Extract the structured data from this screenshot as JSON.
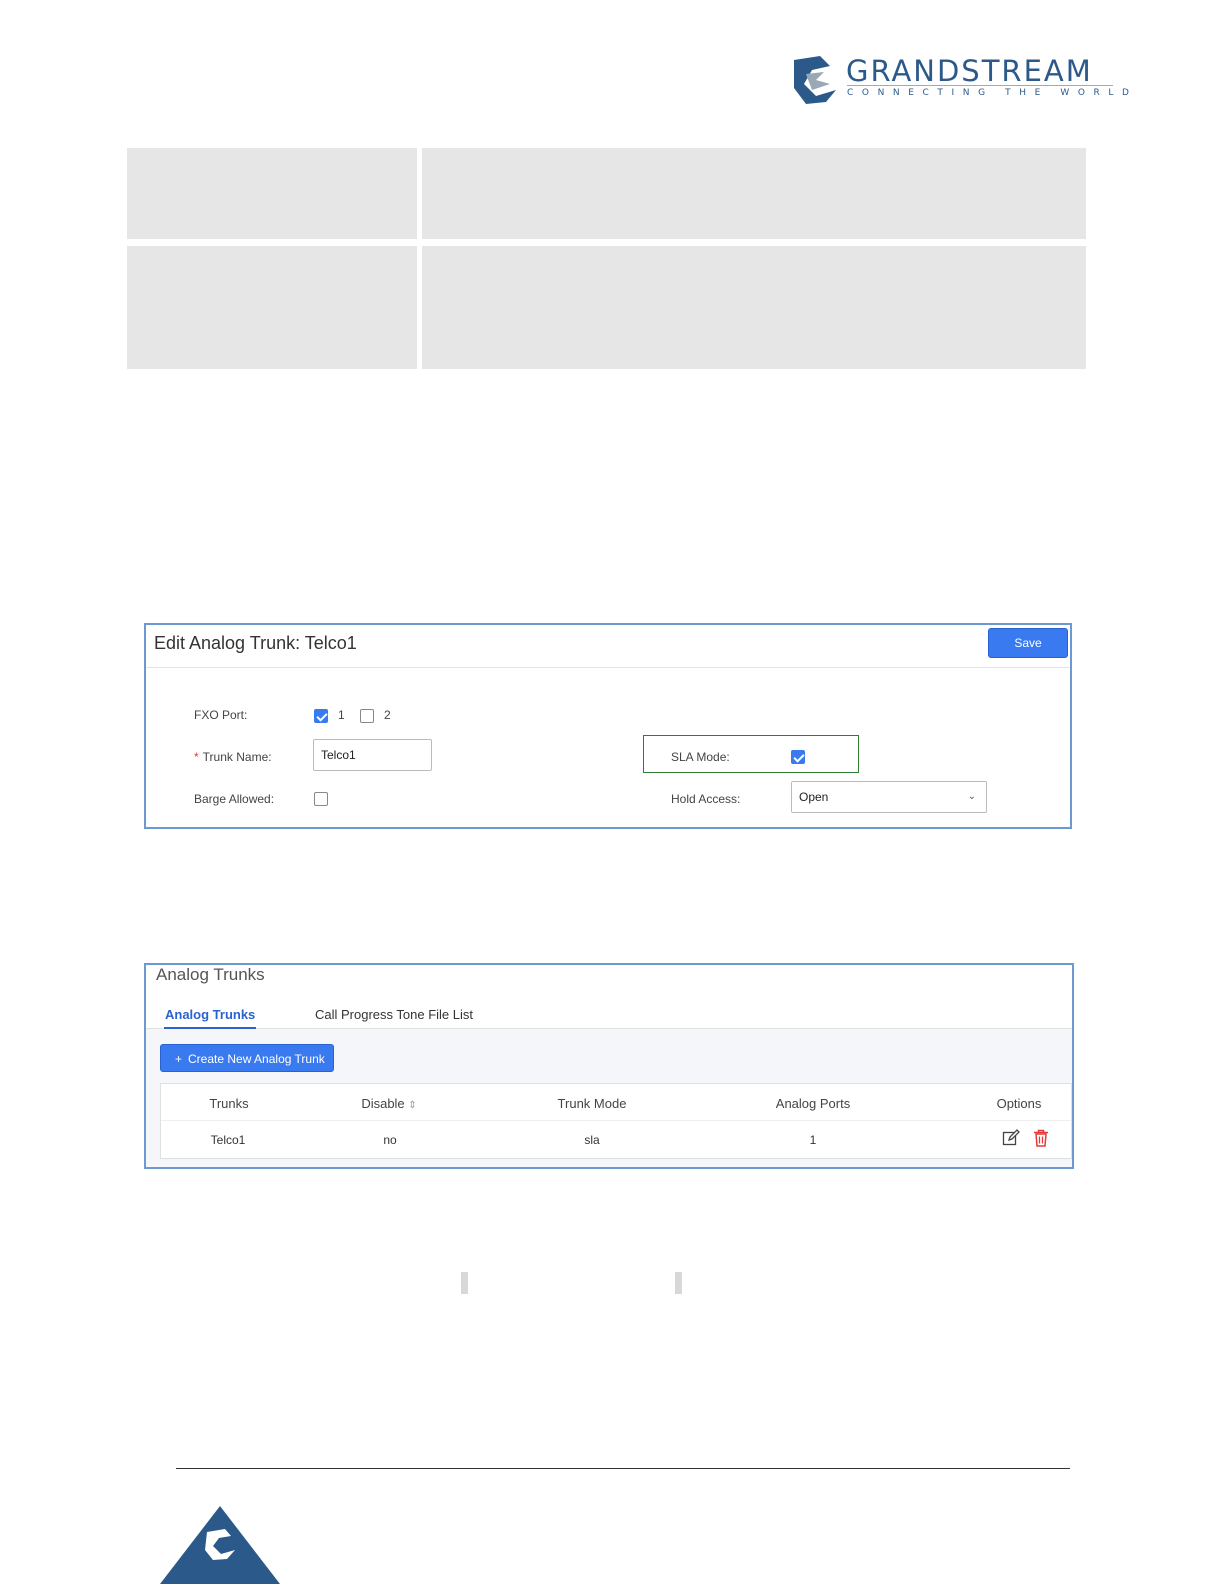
{
  "header": {
    "brand": "GRANDSTREAM",
    "tagline": "CONNECTING THE WORLD"
  },
  "edit_dialog": {
    "title": "Edit Analog Trunk: Telco1",
    "save_label": "Save",
    "fxo_port_label": "FXO Port",
    "fxo_ports": [
      {
        "label": "1",
        "checked": true
      },
      {
        "label": "2",
        "checked": false
      }
    ],
    "trunk_name_label": "Trunk Name",
    "trunk_name_value": "Telco1",
    "barge_allowed_label": "Barge Allowed",
    "barge_allowed_checked": false,
    "sla_mode_label": "SLA Mode",
    "sla_mode_checked": true,
    "hold_access_label": "Hold Access",
    "hold_access_value": "Open",
    "required_mark": "*",
    "colon": ":"
  },
  "trunks_panel": {
    "title": "Analog Trunks",
    "tabs": [
      {
        "label": "Analog Trunks",
        "active": true
      },
      {
        "label": "Call Progress Tone File List",
        "active": false
      }
    ],
    "create_button": "Create New Analog Trunk",
    "create_icon": "+",
    "columns": [
      "Trunks",
      "Disable",
      "Trunk Mode",
      "Analog Ports",
      "Options"
    ],
    "sort_icon": "⇕",
    "rows": [
      {
        "trunks": "Telco1",
        "disable": "no",
        "trunk_mode": "sla",
        "analog_ports": "1"
      }
    ]
  },
  "colors": {
    "accent": "#3a7af0",
    "panel_border": "#6c9ad0",
    "highlight_border": "#2e7d32",
    "delete": "#e53935",
    "brand": "#2b5a8a"
  }
}
